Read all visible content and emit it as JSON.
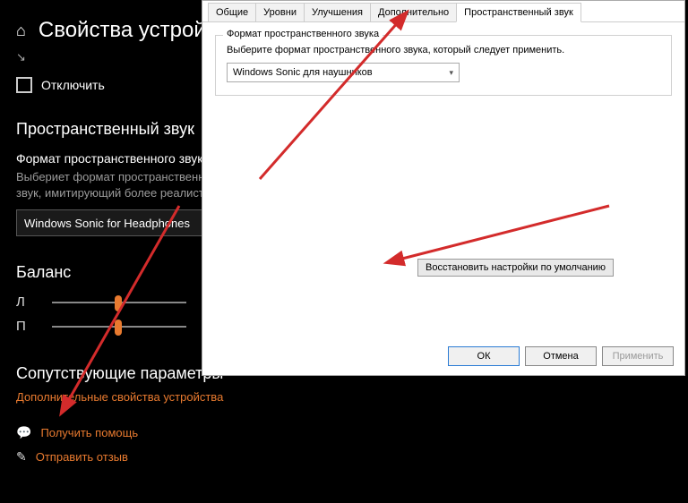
{
  "settings": {
    "title": "Свойства устрой",
    "pin_btn": "",
    "disable_label": "Отключить",
    "spatial_heading": "Пространственный звук",
    "format_label": "Формат пространственного звука",
    "format_desc1": "Выбериет формат пространственно",
    "format_desc2": "звук, имитирующий более реалисти",
    "format_value": "Windows Sonic for Headphones",
    "balance_heading": "Баланс",
    "bal_left": "Л",
    "bal_right": "П",
    "related_heading": "Сопутствующие параметры",
    "advanced_link": "Дополнительные свойства устройства",
    "help_link": "Получить помощь",
    "feedback_link": "Отправить отзыв"
  },
  "dialog": {
    "tabs": {
      "general": "Общие",
      "levels": "Уровни",
      "enhance": "Улучшения",
      "advanced": "Дополнительно",
      "spatial": "Пространственный звук"
    },
    "group_legend": "Формат пространственного звука",
    "group_text": "Выберите формат пространственного звука, который следует применить.",
    "select_value": "Windows Sonic для наушников",
    "restore_btn": "Восстановить настройки по умолчанию",
    "ok": "ОК",
    "cancel": "Отмена",
    "apply": "Применить"
  }
}
